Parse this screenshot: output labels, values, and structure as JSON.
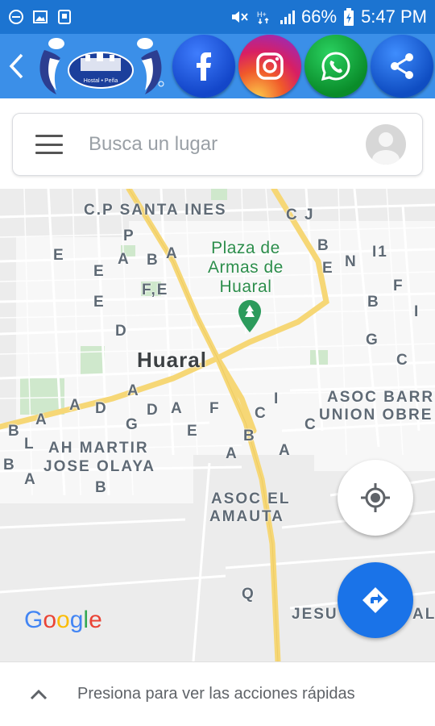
{
  "status_bar": {
    "battery": "66%",
    "time": "5:47 PM"
  },
  "app_bar": {
    "logo_text": "Hostal • Peña",
    "social_buttons": [
      {
        "name": "facebook",
        "icon": "facebook-icon"
      },
      {
        "name": "instagram",
        "icon": "instagram-icon"
      },
      {
        "name": "whatsapp",
        "icon": "whatsapp-icon"
      },
      {
        "name": "share",
        "icon": "share-icon"
      }
    ]
  },
  "search": {
    "placeholder": "Busca un lugar"
  },
  "map": {
    "city": "Huaral",
    "poi_line1": "Plaza de",
    "poi_line2": "Armas de",
    "poi_line3": "Huaral",
    "labels": {
      "cp_santa_ines": "C.P SANTA INES",
      "cj": "C J",
      "ah_martir": "AH MARTIR",
      "jose_olaya": "JOSE OLAYA",
      "asoc_barr": "ASOC BARR",
      "union_obre": "UNION OBRE",
      "asoc_el": "ASOC EL",
      "amauta": "AMAUTA",
      "jesu": "JESU",
      "al": "AL",
      "fe": "F,E",
      "i1": "I1"
    },
    "letters": [
      "E",
      "P",
      "A",
      "B",
      "A",
      "E",
      "E",
      "D",
      "F",
      "G",
      "C",
      "I",
      "B",
      "E",
      "N",
      "H",
      "A",
      "A",
      "D",
      "D",
      "A",
      "F",
      "I",
      "C",
      "E",
      "G",
      "E",
      "B",
      "A",
      "C",
      "B",
      "L",
      "A",
      "B",
      "B",
      "Q",
      "A",
      "I"
    ]
  },
  "attribution": "Google",
  "bottom_bar": {
    "text": "Presiona para ver las acciones rápidas"
  },
  "colors": {
    "status_bar": "#1c74d1",
    "app_bar": "#3b8fe8",
    "map_bg": "#ececec",
    "major_road": "#f6d776",
    "directions_fab": "#1a73e8",
    "poi_green": "#2c8d4b"
  }
}
